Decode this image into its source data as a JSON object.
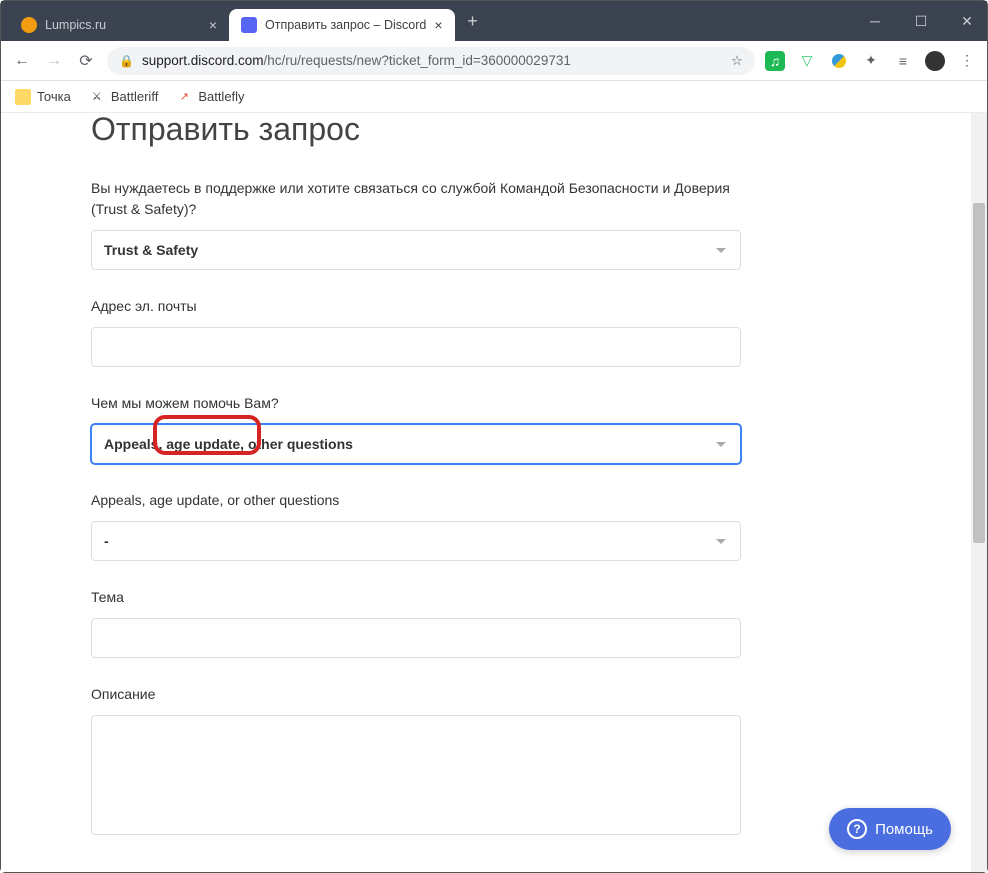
{
  "window": {
    "tabs": [
      {
        "favicon_bg": "#f39c12",
        "title": "Lumpics.ru"
      },
      {
        "favicon_bg": "#5865f2",
        "favicon_text": "□",
        "title": "Отправить запрос – Discord"
      }
    ]
  },
  "address": {
    "host": "support.discord.com",
    "path": "/hc/ru/requests/new?ticket_form_id=360000029731"
  },
  "bookmarks": [
    {
      "icon_bg": "#ffd966",
      "name": "Точка"
    },
    {
      "icon_text": "⚔",
      "name": "Battleriff"
    },
    {
      "icon_color": "#e74c3c",
      "icon_text": "↗",
      "name": "Battlefly"
    }
  ],
  "page": {
    "title": "Отправить запрос",
    "fields": {
      "support_type": {
        "label": "Вы нуждаетесь в поддержке или хотите связаться со службой Командой Безопасности и Доверия (Trust & Safety)?",
        "value": "Trust & Safety"
      },
      "email": {
        "label": "Адрес эл. почты",
        "value": ""
      },
      "help_topic": {
        "label": "Чем мы можем помочь Вам?",
        "value_pre": "Appeals,",
        "value_hl": " age update, ",
        "value_post": "other questions"
      },
      "sub_topic": {
        "label": "Appeals, age update, or other questions",
        "value": "-"
      },
      "subject": {
        "label": "Тема",
        "value": ""
      },
      "description": {
        "label": "Описание",
        "value": ""
      }
    }
  },
  "help_button": "Помощь"
}
